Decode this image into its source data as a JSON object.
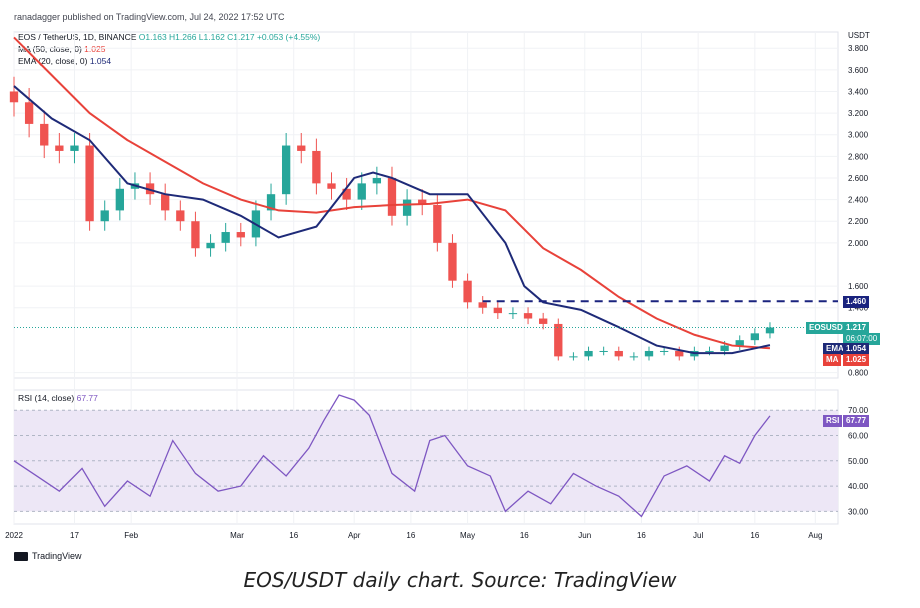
{
  "publisher": "ranadagger published on TradingView.com, Jul 24, 2022 17:52 UTC",
  "legend": {
    "symbol": "EOS / TetherUS, 1D, BINANCE",
    "ohlc": "O1.163 H1.266 L1.162 C1.217 +0.053 (+4.55%)",
    "ma": "MA (50, close, 0)",
    "ma_value": "1.025",
    "ema": "EMA (20, close, 0)",
    "ema_value": "1.054",
    "rsi": "RSI (14, close)",
    "rsi_value": "67.77"
  },
  "currency": "USDT",
  "tags": {
    "level": "1.460",
    "symbol": "EOSUSDT",
    "price": "1.217",
    "countdown": "06:07:00",
    "ema_label": "EMA",
    "ema_value": "1.054",
    "ma_label": "MA",
    "ma_value": "1.025",
    "rsi_label": "RSI",
    "rsi_value": "67.77"
  },
  "brand": "TradingView",
  "caption": "EOS/USDT daily chart. Source: TradingView",
  "colors": {
    "up": "#26a69a",
    "down": "#ef5350",
    "ema": "#1e2a78",
    "ma": "#e8423a",
    "rsi": "#7e57c2",
    "rsi_band": "#ede7f6",
    "level_line": "#1a237e"
  },
  "chart_data": [
    {
      "type": "line",
      "panel": "price",
      "y_ticks": [
        "3.800",
        "3.600",
        "3.400",
        "3.200",
        "3.000",
        "2.800",
        "2.600",
        "2.400",
        "2.200",
        "2.000",
        "1.600",
        "1.400",
        "0.800"
      ],
      "x_ticks": [
        "2022",
        "17",
        "Feb",
        "Mar",
        "16",
        "Apr",
        "16",
        "May",
        "16",
        "Jun",
        "16",
        "Jul",
        "16",
        "Aug"
      ],
      "x_tick_days": [
        0,
        16,
        31,
        59,
        74,
        90,
        105,
        120,
        135,
        151,
        166,
        181,
        196,
        212
      ],
      "y_range": [
        0.75,
        3.95
      ],
      "x_range": [
        0,
        218
      ],
      "horizontal_level": 1.46,
      "series": [
        {
          "name": "MA",
          "x": [
            0,
            10,
            20,
            30,
            40,
            50,
            60,
            70,
            80,
            90,
            100,
            110,
            120,
            130,
            140,
            150,
            160,
            170,
            180,
            190,
            200
          ],
          "y": [
            3.9,
            3.55,
            3.2,
            2.95,
            2.75,
            2.55,
            2.4,
            2.3,
            2.28,
            2.33,
            2.35,
            2.36,
            2.4,
            2.3,
            1.95,
            1.75,
            1.5,
            1.3,
            1.15,
            1.05,
            1.025
          ]
        },
        {
          "name": "EMA",
          "x": [
            0,
            10,
            20,
            30,
            40,
            50,
            60,
            70,
            80,
            90,
            95,
            100,
            110,
            120,
            130,
            135,
            140,
            150,
            160,
            170,
            180,
            190,
            200
          ],
          "y": [
            3.45,
            3.15,
            2.95,
            2.55,
            2.45,
            2.4,
            2.25,
            2.05,
            2.15,
            2.6,
            2.65,
            2.6,
            2.45,
            2.45,
            2.0,
            1.6,
            1.45,
            1.38,
            1.22,
            1.05,
            0.98,
            0.98,
            1.054
          ]
        }
      ],
      "candles": {
        "x": [
          0,
          4,
          8,
          12,
          16,
          20,
          24,
          28,
          32,
          36,
          40,
          44,
          48,
          52,
          56,
          60,
          64,
          68,
          72,
          76,
          80,
          84,
          88,
          92,
          96,
          100,
          104,
          108,
          112,
          116,
          120,
          124,
          128,
          132,
          136,
          140,
          144,
          148,
          152,
          156,
          160,
          164,
          168,
          172,
          176,
          180,
          184,
          188,
          192,
          196,
          200
        ],
        "open": [
          3.4,
          3.3,
          3.1,
          2.9,
          2.85,
          2.9,
          2.2,
          2.3,
          2.5,
          2.55,
          2.45,
          2.3,
          2.2,
          1.95,
          2.0,
          2.1,
          2.05,
          2.3,
          2.45,
          2.9,
          2.85,
          2.55,
          2.5,
          2.4,
          2.55,
          2.6,
          2.25,
          2.4,
          2.35,
          2.0,
          1.65,
          1.45,
          1.4,
          1.35,
          1.35,
          1.3,
          1.25,
          0.95,
          0.95,
          1.0,
          1.0,
          0.95,
          0.95,
          1.0,
          1.0,
          0.95,
          1.0,
          1.0,
          1.05,
          1.1,
          1.163
        ],
        "close": [
          3.3,
          3.1,
          2.9,
          2.85,
          2.9,
          2.2,
          2.3,
          2.5,
          2.55,
          2.45,
          2.3,
          2.2,
          1.95,
          2.0,
          2.1,
          2.05,
          2.3,
          2.45,
          2.9,
          2.85,
          2.55,
          2.5,
          2.4,
          2.55,
          2.6,
          2.25,
          2.4,
          2.35,
          2.0,
          1.65,
          1.45,
          1.4,
          1.35,
          1.35,
          1.3,
          1.25,
          0.95,
          0.95,
          1.0,
          1.0,
          0.95,
          0.95,
          1.0,
          1.0,
          0.95,
          1.0,
          1.0,
          1.05,
          1.1,
          1.163,
          1.217
        ]
      }
    },
    {
      "type": "line",
      "panel": "rsi",
      "y_ticks": [
        "70.00",
        "60.00",
        "50.00",
        "40.00",
        "30.00"
      ],
      "band": [
        30,
        70
      ],
      "y_range": [
        25,
        78
      ],
      "series": [
        {
          "name": "RSI",
          "x": [
            0,
            6,
            12,
            18,
            24,
            30,
            36,
            42,
            48,
            54,
            60,
            66,
            72,
            78,
            82,
            86,
            90,
            94,
            100,
            106,
            110,
            114,
            120,
            126,
            130,
            136,
            142,
            148,
            154,
            160,
            166,
            172,
            178,
            184,
            188,
            192,
            196,
            200
          ],
          "y": [
            50,
            44,
            38,
            47,
            32,
            42,
            36,
            58,
            45,
            38,
            40,
            52,
            44,
            55,
            66,
            76,
            74,
            68,
            45,
            38,
            58,
            60,
            48,
            44,
            30,
            38,
            33,
            45,
            40,
            36,
            28,
            44,
            48,
            42,
            52,
            49,
            60,
            67.77
          ]
        }
      ]
    }
  ]
}
